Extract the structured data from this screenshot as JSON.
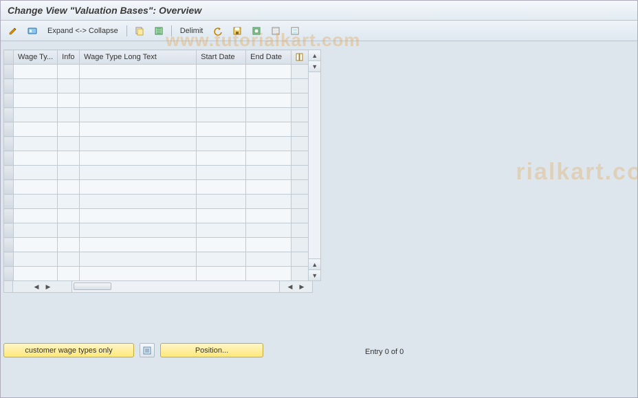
{
  "title": "Change View \"Valuation Bases\": Overview",
  "toolbar": {
    "expand_collapse": "Expand <-> Collapse",
    "delimit": "Delimit"
  },
  "table": {
    "columns": {
      "wage_type": "Wage Ty...",
      "info": "Info",
      "long_text": "Wage Type Long Text",
      "start_date": "Start Date",
      "end_date": "End Date"
    },
    "row_count": 15
  },
  "footer": {
    "customer_wage_btn": "customer wage types only",
    "position_btn": "Position...",
    "entry_text": "Entry 0 of 0"
  },
  "watermark": "www.tutorialkart.com",
  "watermark2": "rialkart.com"
}
